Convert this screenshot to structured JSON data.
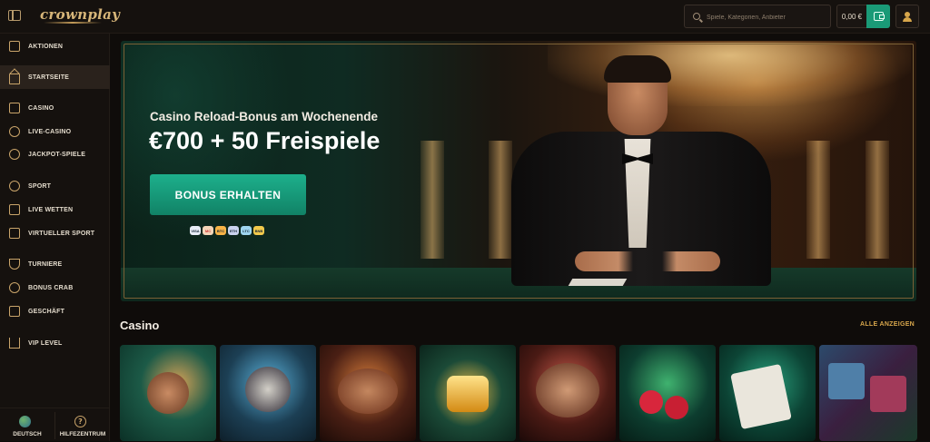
{
  "header": {
    "logo": "crownplay",
    "search_placeholder": "Spiele, Kategorien, Anbieter",
    "balance": "0,00 €"
  },
  "sidebar": {
    "items": [
      {
        "label": "AKTIONEN",
        "icon": "gift-icon"
      },
      {
        "label": "STARTSEITE",
        "icon": "home-icon",
        "active": true
      },
      {
        "label": "CASINO",
        "icon": "slot-machine-icon"
      },
      {
        "label": "LIVE-CASINO",
        "icon": "live-casino-icon"
      },
      {
        "label": "JACKPOT-SPIELE",
        "icon": "jackpot-icon"
      },
      {
        "label": "SPORT",
        "icon": "soccer-ball-icon"
      },
      {
        "label": "LIVE WETTEN",
        "icon": "live-bets-icon"
      },
      {
        "label": "VIRTUELLER SPORT",
        "icon": "gamepad-icon"
      },
      {
        "label": "TURNIERE",
        "icon": "trophy-icon"
      },
      {
        "label": "BONUS CRAB",
        "icon": "bonus-crab-icon"
      },
      {
        "label": "GESCHÄFT",
        "icon": "shop-icon"
      },
      {
        "label": "VIP LEVEL",
        "icon": "crown-icon"
      }
    ],
    "bottom": {
      "language": "DEUTSCH",
      "help": "HILFEZENTRUM"
    }
  },
  "hero": {
    "subtitle": "Casino Reload-Bonus am Wochenende",
    "title": "€700 + 50 Freispiele",
    "cta": "BONUS ERHALTEN",
    "payments": [
      "VISA",
      "MC",
      "BTC",
      "ETH",
      "LTC",
      "BNB"
    ]
  },
  "casino": {
    "title": "Casino",
    "view_all": "ALLE ANZEIGEN",
    "games": [
      {
        "name": "Viking game",
        "color": "#0f4a3c"
      },
      {
        "name": "Dark magician game",
        "color": "#1c3f54"
      },
      {
        "name": "Pirate duo game",
        "color": "#2f1b14"
      },
      {
        "name": "Diamond game",
        "color": "#0e2b22"
      },
      {
        "name": "Poker couple game",
        "color": "#3a1712"
      },
      {
        "name": "Fruit cherries game",
        "color": "#0d3d2f"
      },
      {
        "name": "Cards and chips game",
        "color": "#0c4435"
      },
      {
        "name": "Slot collage game",
        "color": "#1d2a3f"
      }
    ]
  }
}
